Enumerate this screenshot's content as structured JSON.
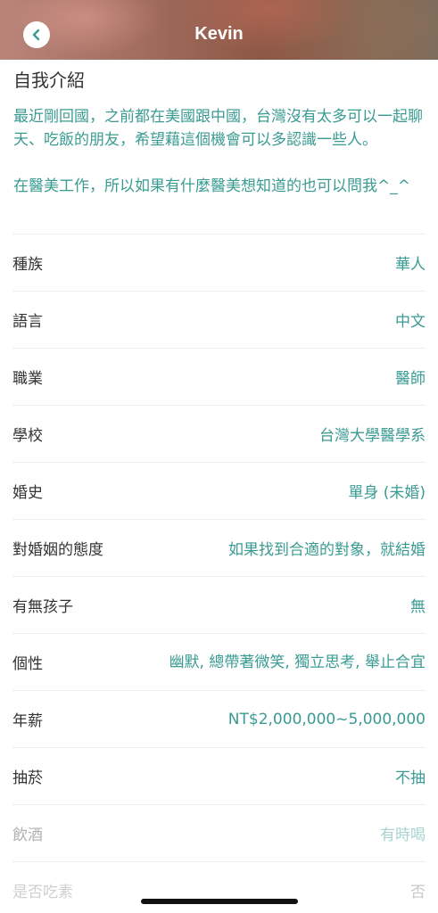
{
  "header": {
    "title": "Kevin",
    "back_icon": "chevron-left-icon",
    "accent_color": "#3a9b93"
  },
  "intro": {
    "heading": "自我介紹",
    "paragraphs": [
      "最近剛回國，之前都在美國跟中國，台灣沒有太多可以一起聊天、吃飯的朋友，希望藉這個機會可以多認識一些人。",
      "在醫美工作，所以如果有什麼醫美想知道的也可以問我^_^"
    ]
  },
  "details": [
    {
      "label": "種族",
      "value": "華人"
    },
    {
      "label": "語言",
      "value": "中文"
    },
    {
      "label": "職業",
      "value": "醫師"
    },
    {
      "label": "學校",
      "value": "台灣大學醫學系"
    },
    {
      "label": "婚史",
      "value": "單身 (未婚)"
    },
    {
      "label": "對婚姻的態度",
      "value": "如果找到合適的對象，就結婚"
    },
    {
      "label": "有無孩子",
      "value": "無"
    },
    {
      "label": "個性",
      "value": "幽默, 總帶著微笑, 獨立思考, 舉止合宜"
    },
    {
      "label": "年薪",
      "value": "NT$2,000,000~5,000,000"
    },
    {
      "label": "抽菸",
      "value": "不抽"
    },
    {
      "label": "飲酒",
      "value": "有時喝"
    },
    {
      "label": "是否吃素",
      "value": "否"
    }
  ]
}
